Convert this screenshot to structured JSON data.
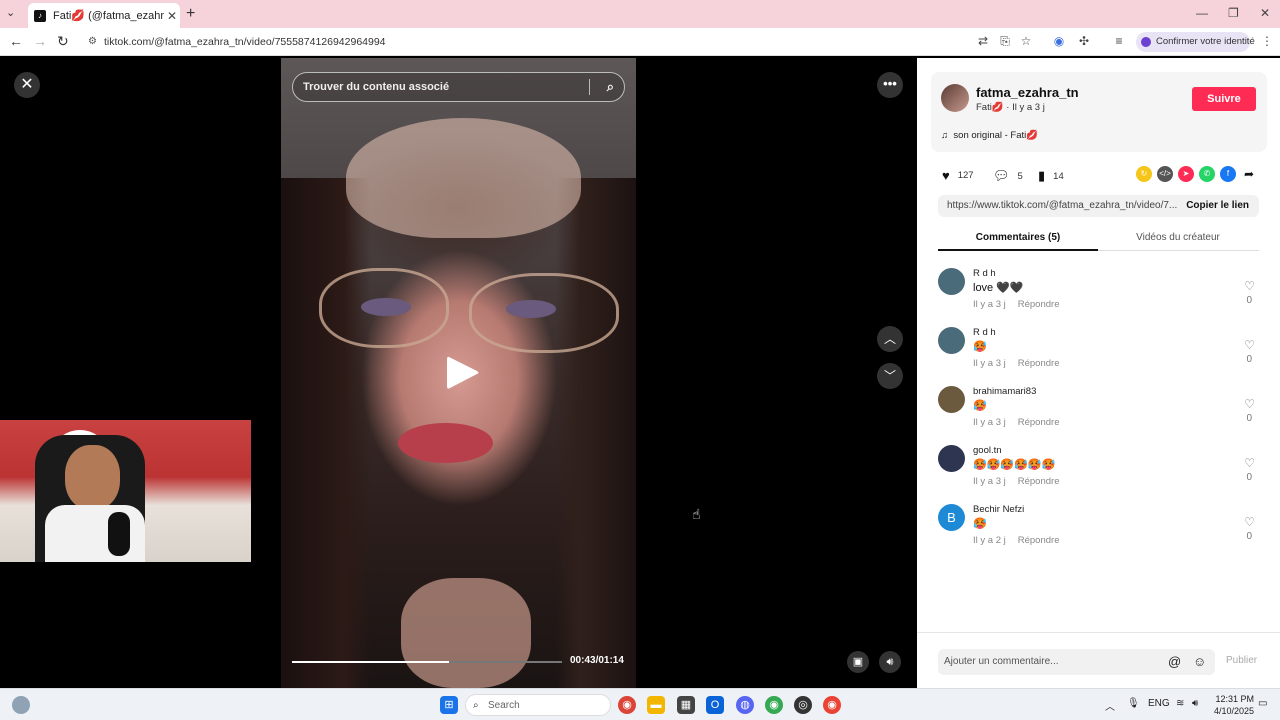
{
  "browser": {
    "tab_title": "Fati💋 (@fatma_ezahra_tn) | Ti",
    "tab_close": "✕",
    "new_tab": "+",
    "url": "tiktok.com/@fatma_ezahra_tn/video/7555874126942964994",
    "identity_label": "Confirmer votre identité"
  },
  "video": {
    "search_placeholder": "Trouver du contenu associé",
    "current_time": "00:43/01:14",
    "progress": 0.58
  },
  "creator": {
    "username": "fatma_ezahra_tn",
    "subline": "Fati💋 · Il y a 3 j",
    "follow_label": "Suivre",
    "music": "son original - Fati💋"
  },
  "stats": {
    "likes": "127",
    "comments": "5",
    "saves": "14"
  },
  "link": {
    "url": "https://www.tiktok.com/@fatma_ezahra_tn/video/7...",
    "copy_label": "Copier le lien"
  },
  "tabs": {
    "comments": "Commentaires (5)",
    "creator_videos": "Vidéos du créateur"
  },
  "comments": [
    {
      "name": "R d h",
      "text": "love 🖤🖤",
      "time": "Il y a 3 j",
      "reply": "Répondre",
      "likes": "0",
      "avatar_color": "#4a6b7a"
    },
    {
      "name": "R d h",
      "text": "🥵",
      "time": "Il y a 3 j",
      "reply": "Répondre",
      "likes": "0",
      "avatar_color": "#4a6b7a"
    },
    {
      "name": "brahimamari83",
      "text": "🥵",
      "time": "Il y a 3 j",
      "reply": "Répondre",
      "likes": "0",
      "avatar_color": "#6b5a3e"
    },
    {
      "name": "gool.tn",
      "text": "🥵🥵🥵🥵🥵🥵",
      "time": "Il y a 3 j",
      "reply": "Répondre",
      "likes": "0",
      "avatar_color": "#2d3550"
    },
    {
      "name": "Bechir Nefzi",
      "text": "🥵",
      "time": "Il y a 2 j",
      "reply": "Répondre",
      "likes": "0",
      "avatar_color": "#1e8ad6",
      "avatar_letter": "B"
    }
  ],
  "composer": {
    "placeholder": "Ajouter un commentaire...",
    "publish_label": "Publier"
  },
  "taskbar": {
    "search_placeholder": "Search",
    "lang": "ENG",
    "time": "12:31 PM",
    "date": "4/10/2025"
  }
}
